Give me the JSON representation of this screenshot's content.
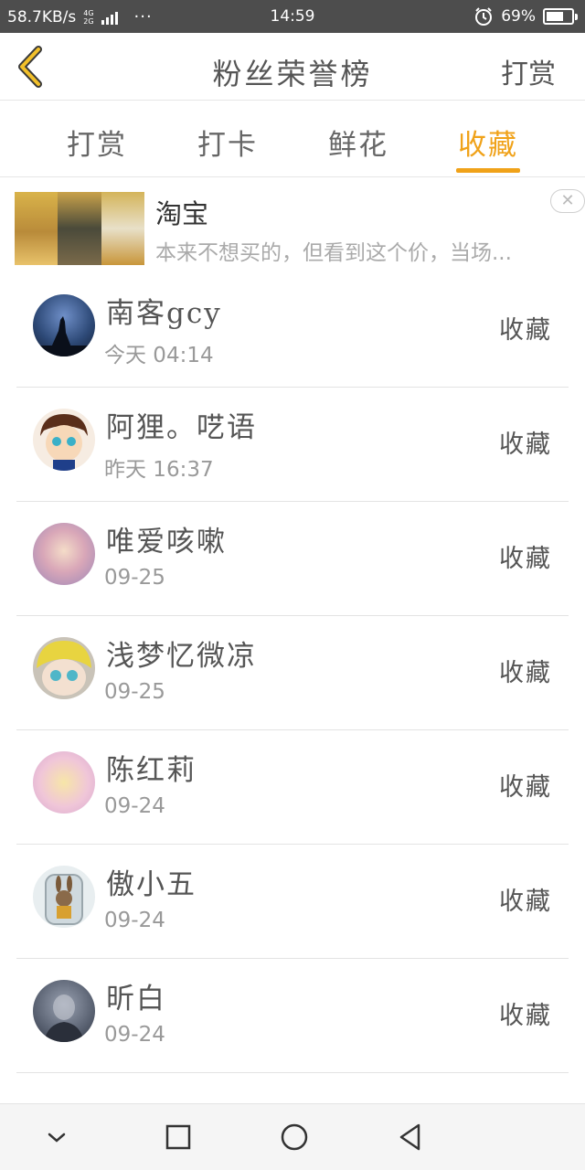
{
  "status_bar": {
    "speed": "58.7KB/s",
    "net_top": "4G",
    "net_bottom": "2G",
    "more": "···",
    "time": "14:59",
    "battery": "69%",
    "battery_level": 0.69
  },
  "header": {
    "title": "粉丝荣誉榜",
    "action": "打赏"
  },
  "tabs": [
    {
      "label": "打赏",
      "active": false
    },
    {
      "label": "打卡",
      "active": false
    },
    {
      "label": "鲜花",
      "active": false
    },
    {
      "label": "收藏",
      "active": true
    }
  ],
  "ad": {
    "title": "淘宝",
    "description": "本来不想买的，但看到这个价，当场..."
  },
  "fans": [
    {
      "name": "南客gcy",
      "time": "今天 04:14",
      "action": "收藏",
      "avatar_color": "#2e4a78"
    },
    {
      "name": "阿狸。呓语",
      "time": "昨天 16:37",
      "action": "收藏",
      "avatar_color": "#8b5a3c"
    },
    {
      "name": "唯爱咳嗽",
      "time": "09-25",
      "action": "收藏",
      "avatar_color": "#d9a7b8"
    },
    {
      "name": "浅梦忆微凉",
      "time": "09-25",
      "action": "收藏",
      "avatar_color": "#e8d440"
    },
    {
      "name": "陈红莉",
      "time": "09-24",
      "action": "收藏",
      "avatar_color": "#f0c6d8"
    },
    {
      "name": "傲小五",
      "time": "09-24",
      "action": "收藏",
      "avatar_color": "#cfd9de"
    },
    {
      "name": "昕白",
      "time": "09-24",
      "action": "收藏",
      "avatar_color": "#5a6272"
    }
  ],
  "colors": {
    "accent": "#f0a219",
    "status_bar": "#4d4d4d"
  },
  "nav": {
    "icons": [
      "chevron-down-icon",
      "square-icon",
      "circle-icon",
      "triangle-back-icon"
    ]
  }
}
